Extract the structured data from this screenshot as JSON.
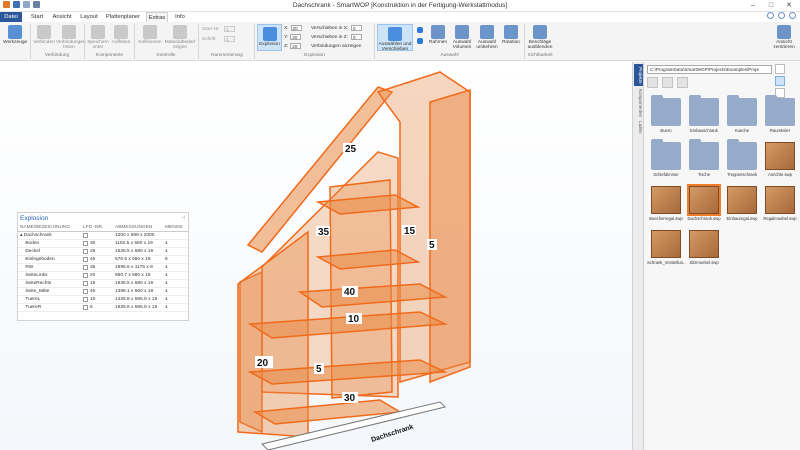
{
  "window": {
    "title": "Dachschrank - SmartWOP [Konstruktion in der Fertigung-Werkstattmodus]"
  },
  "tabs": [
    {
      "label": "Datei"
    },
    {
      "label": "Start"
    },
    {
      "label": "Ansicht"
    },
    {
      "label": "Layout"
    },
    {
      "label": "Plattenplaner"
    },
    {
      "label": "Extras"
    },
    {
      "label": "Info"
    }
  ],
  "ribbon": {
    "werkzeuge": "Werkzeuge",
    "verbindung": {
      "b1": "Verbinden",
      "b2": "Verbindungen lösen",
      "group": "Verbindung"
    },
    "komponente": {
      "b1": "Speichern unter",
      "b2": "Auflösen",
      "group": "Komponente"
    },
    "kontrolle": {
      "b1": "Kollisionen",
      "b2": "Materialbedarf zeigen",
      "group": "Kontrolle"
    },
    "nummerierung": {
      "start": "Start Nr.",
      "schritt": "Schritt",
      "start_value": "1",
      "schritt_value": "1",
      "group": "Nummerierung"
    },
    "explosion": {
      "button": "Explosion",
      "x_label": "X:",
      "y_label": "Y:",
      "z_label": "Z:",
      "x": "20",
      "y": "20",
      "z": "20",
      "vx_label": "Verschieben in X:",
      "vz_label": "Verschieben in Z:",
      "vx": "0",
      "vz": "0",
      "connections": "Verbindungen anzeigen",
      "group": "Explosion"
    },
    "auswahl": {
      "select": "Auswählen und Verschieben",
      "rahmen": "Rahmen",
      "alle": "Auswahl Volumen",
      "umkehren": "Auswahl umkehren",
      "rotation": "Rotation",
      "group": "Auswahl"
    },
    "sichtbarkeit": {
      "button": "Beschläge ausblenden",
      "group": "Sichtbarkeit"
    },
    "center": "Ansicht zentrieren"
  },
  "explosion_panel": {
    "title": "Explosion",
    "headers": [
      "NAME/BEZEICHNUNG",
      "LFD.-NR.",
      "ABMESSUNGEN",
      "MENGE"
    ],
    "root": {
      "name": "Dachschrank",
      "dims": "1200 x 599 x 2000"
    },
    "rows": [
      {
        "name": "Boden",
        "nr": "30",
        "dims": "1162.5 x 580 x 19",
        "qty": "1"
      },
      {
        "name": "Deckel",
        "nr": "25",
        "dims": "1528.5 x 580 x 19",
        "qty": "1"
      },
      {
        "name": "Einlegeboden",
        "nr": "45",
        "dims": "570.5 x 550 x 18",
        "qty": "6"
      },
      {
        "name": "RW",
        "nr": "35",
        "dims": "1895.6 x 1175 x 8",
        "qty": "1"
      },
      {
        "name": "SeiteLinks",
        "nr": "20",
        "dims": "950.7 x 580 x 19",
        "qty": "1"
      },
      {
        "name": "SeiteRechts",
        "nr": "15",
        "dims": "1935.5 x 580 x 19",
        "qty": "1"
      },
      {
        "name": "Seite_Mitte",
        "nr": "40",
        "dims": "1399.1 x 560 x 18",
        "qty": "1"
      },
      {
        "name": "TuereL",
        "nr": "10",
        "dims": "1426.8 x 595.5 x 19",
        "qty": "1"
      },
      {
        "name": "TuereR",
        "nr": "5",
        "dims": "1925.6 x 595.5 x 19",
        "qty": "1"
      }
    ]
  },
  "model": {
    "part_labels": [
      "25",
      "35",
      "15",
      "5",
      "40",
      "10",
      "20",
      "5",
      "30"
    ],
    "floor_label": "Dachschrank"
  },
  "projects": {
    "vtabs": [
      "Projekte",
      "Komponenten",
      "Laden"
    ],
    "path": "C:\\ProgramData\\SmartWOP\\Projects\\Examples\\Proje",
    "items": [
      {
        "label": "Buero",
        "kind": "folder"
      },
      {
        "label": "Einbauschrank",
        "kind": "folder"
      },
      {
        "label": "Kueche",
        "kind": "folder"
      },
      {
        "label": "Raumteiler",
        "kind": "folder"
      },
      {
        "label": "Schiefdimmer",
        "kind": "folder"
      },
      {
        "label": "Tische",
        "kind": "folder"
      },
      {
        "label": "Treppenschrank",
        "kind": "folder"
      },
      {
        "label": "Anrichte.swp",
        "kind": "cab"
      },
      {
        "label": "Buecherregal.swp",
        "kind": "cab"
      },
      {
        "label": "Dachschrank.swp",
        "kind": "cab",
        "selected": true
      },
      {
        "label": "Einbauregal.swp",
        "kind": "cab"
      },
      {
        "label": "Regalmoebel.swp",
        "kind": "cab"
      },
      {
        "label": "Schrank_Vorstellun...",
        "kind": "cab"
      },
      {
        "label": "Sitzmoebel.swp",
        "kind": "cab"
      }
    ]
  },
  "colors": {
    "accent": "#2b579a",
    "panel_orange": "#e98a45",
    "edge": "#f06a1a"
  }
}
